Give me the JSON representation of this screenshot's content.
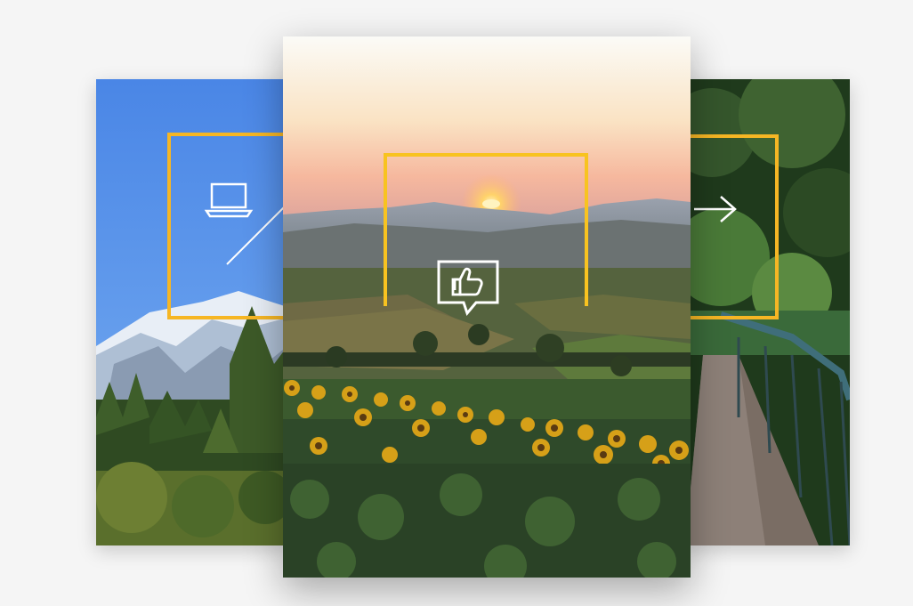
{
  "cards": [
    {
      "name": "left",
      "scene": "mountain-forest",
      "icon": "laptop-icon"
    },
    {
      "name": "center",
      "scene": "sunflower-sunset",
      "icon": "thumbs-up-chat-icon"
    },
    {
      "name": "right",
      "scene": "forest-bridge",
      "icon": "arrow-right-icon"
    }
  ],
  "colors": {
    "frame": "#f6b624",
    "background": "#f5f5f5"
  }
}
